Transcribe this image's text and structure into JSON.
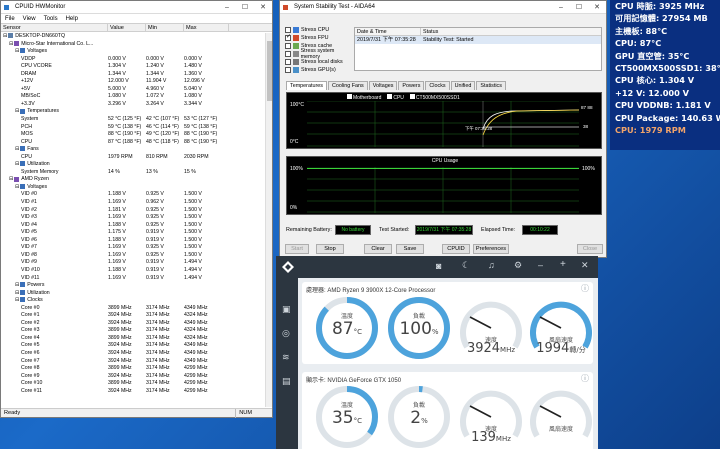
{
  "hwmonitor": {
    "title": "CPUID HWMonitor",
    "menu": [
      "File",
      "View",
      "Tools",
      "Help"
    ],
    "columns": [
      "Sensor",
      "Value",
      "Min",
      "Max"
    ],
    "rows": [
      {
        "i": 0,
        "name": "DESKTOP-DN660TQ",
        "v": "",
        "min": "",
        "max": ""
      },
      {
        "i": 1,
        "name": "Micro-Star International Co. L...",
        "v": "",
        "min": "",
        "max": ""
      },
      {
        "i": 2,
        "name": "Voltages",
        "v": "",
        "min": "",
        "max": ""
      },
      {
        "i": 3,
        "name": "VDDP",
        "v": "0.000 V",
        "min": "0.000 V",
        "max": "0.000 V"
      },
      {
        "i": 3,
        "name": "CPU VCORE",
        "v": "1.304 V",
        "min": "1.240 V",
        "max": "1.480 V"
      },
      {
        "i": 3,
        "name": "DRAM",
        "v": "1.344 V",
        "min": "1.344 V",
        "max": "1.360 V"
      },
      {
        "i": 3,
        "name": "+12V",
        "v": "12.000 V",
        "min": "11.904 V",
        "max": "12.096 V"
      },
      {
        "i": 3,
        "name": "+5V",
        "v": "5.000 V",
        "min": "4.960 V",
        "max": "5.040 V"
      },
      {
        "i": 3,
        "name": "MB/SoC",
        "v": "1.080 V",
        "min": "1.072 V",
        "max": "1.080 V"
      },
      {
        "i": 3,
        "name": "+3.3V",
        "v": "3.296 V",
        "min": "3.264 V",
        "max": "3.344 V"
      },
      {
        "i": 2,
        "name": "Temperatures",
        "v": "",
        "min": "",
        "max": ""
      },
      {
        "i": 3,
        "name": "System",
        "v": "52 °C (125 °F)",
        "min": "42 °C (107 °F)",
        "max": "53 °C (127 °F)"
      },
      {
        "i": 3,
        "name": "PCH",
        "v": "59 °C (138 °F)",
        "min": "46 °C (114 °F)",
        "max": "59 °C (138 °F)"
      },
      {
        "i": 3,
        "name": "MOS",
        "v": "88 °C (190 °F)",
        "min": "49 °C (120 °F)",
        "max": "88 °C (190 °F)"
      },
      {
        "i": 3,
        "name": "CPU",
        "v": "87 °C (188 °F)",
        "min": "48 °C (118 °F)",
        "max": "88 °C (190 °F)"
      },
      {
        "i": 2,
        "name": "Fans",
        "v": "",
        "min": "",
        "max": ""
      },
      {
        "i": 3,
        "name": "CPU",
        "v": "1979 RPM",
        "min": "810 RPM",
        "max": "2030 RPM"
      },
      {
        "i": 2,
        "name": "Utilization",
        "v": "",
        "min": "",
        "max": ""
      },
      {
        "i": 3,
        "name": "System Memory",
        "v": "14 %",
        "min": "13 %",
        "max": "15 %"
      },
      {
        "i": 1,
        "name": "AMD Ryzen",
        "v": "",
        "min": "",
        "max": ""
      },
      {
        "i": 2,
        "name": "Voltages",
        "v": "",
        "min": "",
        "max": ""
      },
      {
        "i": 3,
        "name": "VID #0",
        "v": "1.188 V",
        "min": "0.925 V",
        "max": "1.500 V"
      },
      {
        "i": 3,
        "name": "VID #1",
        "v": "1.169 V",
        "min": "0.962 V",
        "max": "1.500 V"
      },
      {
        "i": 3,
        "name": "VID #2",
        "v": "1.181 V",
        "min": "0.925 V",
        "max": "1.500 V"
      },
      {
        "i": 3,
        "name": "VID #3",
        "v": "1.169 V",
        "min": "0.925 V",
        "max": "1.500 V"
      },
      {
        "i": 3,
        "name": "VID #4",
        "v": "1.188 V",
        "min": "0.925 V",
        "max": "1.500 V"
      },
      {
        "i": 3,
        "name": "VID #5",
        "v": "1.175 V",
        "min": "0.919 V",
        "max": "1.500 V"
      },
      {
        "i": 3,
        "name": "VID #6",
        "v": "1.188 V",
        "min": "0.919 V",
        "max": "1.500 V"
      },
      {
        "i": 3,
        "name": "VID #7",
        "v": "1.169 V",
        "min": "0.925 V",
        "max": "1.500 V"
      },
      {
        "i": 3,
        "name": "VID #8",
        "v": "1.169 V",
        "min": "0.925 V",
        "max": "1.500 V"
      },
      {
        "i": 3,
        "name": "VID #9",
        "v": "1.169 V",
        "min": "0.919 V",
        "max": "1.494 V"
      },
      {
        "i": 3,
        "name": "VID #10",
        "v": "1.188 V",
        "min": "0.919 V",
        "max": "1.494 V"
      },
      {
        "i": 3,
        "name": "VID #11",
        "v": "1.169 V",
        "min": "0.919 V",
        "max": "1.494 V"
      },
      {
        "i": 2,
        "name": "Powers",
        "v": "",
        "min": "",
        "max": ""
      },
      {
        "i": 2,
        "name": "Utilization",
        "v": "",
        "min": "",
        "max": ""
      },
      {
        "i": 2,
        "name": "Clocks",
        "v": "",
        "min": "",
        "max": ""
      },
      {
        "i": 3,
        "name": "Core #0",
        "v": "3899 MHz",
        "min": "3174 MHz",
        "max": "4349 MHz"
      },
      {
        "i": 3,
        "name": "Core #1",
        "v": "3924 MHz",
        "min": "3174 MHz",
        "max": "4324 MHz"
      },
      {
        "i": 3,
        "name": "Core #2",
        "v": "3924 MHz",
        "min": "3174 MHz",
        "max": "4349 MHz"
      },
      {
        "i": 3,
        "name": "Core #3",
        "v": "3899 MHz",
        "min": "3174 MHz",
        "max": "4324 MHz"
      },
      {
        "i": 3,
        "name": "Core #4",
        "v": "3899 MHz",
        "min": "3174 MHz",
        "max": "4324 MHz"
      },
      {
        "i": 3,
        "name": "Core #5",
        "v": "3924 MHz",
        "min": "3174 MHz",
        "max": "4349 MHz"
      },
      {
        "i": 3,
        "name": "Core #6",
        "v": "3924 MHz",
        "min": "3174 MHz",
        "max": "4349 MHz"
      },
      {
        "i": 3,
        "name": "Core #7",
        "v": "3924 MHz",
        "min": "3174 MHz",
        "max": "4349 MHz"
      },
      {
        "i": 3,
        "name": "Core #8",
        "v": "3899 MHz",
        "min": "3174 MHz",
        "max": "4299 MHz"
      },
      {
        "i": 3,
        "name": "Core #9",
        "v": "3924 MHz",
        "min": "3174 MHz",
        "max": "4299 MHz"
      },
      {
        "i": 3,
        "name": "Core #10",
        "v": "3899 MHz",
        "min": "3174 MHz",
        "max": "4299 MHz"
      },
      {
        "i": 3,
        "name": "Core #11",
        "v": "3924 MHz",
        "min": "3174 MHz",
        "max": "4299 MHz"
      }
    ],
    "status_left": "Ready",
    "status_num": "NUM"
  },
  "aida": {
    "title": "System Stability Test - AIDA64",
    "stress": [
      {
        "label": "Stress CPU",
        "checked": false
      },
      {
        "label": "Stress FPU",
        "checked": true
      },
      {
        "label": "Stress cache",
        "checked": false
      },
      {
        "label": "Stress system memory",
        "checked": false
      },
      {
        "label": "Stress local disks",
        "checked": false
      },
      {
        "label": "Stress GPU(s)",
        "checked": false
      }
    ],
    "table_head": [
      "Date & Time",
      "Status"
    ],
    "table_row": [
      "2019/7/31 下午 07:35:28",
      "Stability Test: Started"
    ],
    "tabs": [
      "Temperatures",
      "Cooling Fans",
      "Voltages",
      "Powers",
      "Clocks",
      "Unified",
      "Statistics"
    ],
    "legend": [
      "Motherboard",
      "CPU",
      "CT500MX500SSD1"
    ],
    "temp_top": "100°C",
    "temp_bottom": "0°C",
    "temp_time": "下午 07:35:28",
    "temp_r1": "87 88",
    "temp_r2": "38",
    "usage_title": "CPU Usage",
    "usage_top": "100%",
    "usage_bottom": "0%",
    "usage_right_top": "100%",
    "remaining_label": "Remaining Battery:",
    "remaining_val": "No battery",
    "started_label": "Test Started:",
    "started_val": "2019/7/31 下午 07:35:28",
    "elapsed_label": "Elapsed Time:",
    "elapsed_val": "00:10:22",
    "buttons": {
      "start": "Start",
      "stop": "Stop",
      "clear": "Clear",
      "save": "Save",
      "cpuid": "CPUID",
      "prefs": "Preferences",
      "close": "Close"
    }
  },
  "overlay": {
    "lines": [
      {
        "text": "CPU 時脈: 3925 MHz",
        "color": "#ffffff"
      },
      {
        "text": "可用記憶體: 27954 MB",
        "color": "#ffffff"
      },
      {
        "text": "主機板: 88°C",
        "color": "#ffffff"
      },
      {
        "text": "CPU: 87°C",
        "color": "#ffffff"
      },
      {
        "text": "GPU 直空管: 35°C",
        "color": "#ffffff"
      },
      {
        "text": "CT500MX500SSD1: 38°C",
        "color": "#ffffff"
      },
      {
        "text": "CPU 核心: 1.304 V",
        "color": "#ffffff"
      },
      {
        "text": "+12 V: 12.000 V",
        "color": "#ffffff"
      },
      {
        "text": "CPU VDDNB: 1.181 V",
        "color": "#ffffff"
      },
      {
        "text": "CPU Package: 140.63 W",
        "color": "#ffffff"
      },
      {
        "text": "CPU: 1979 RPM",
        "color": "#f2a46a"
      }
    ]
  },
  "nzxt": {
    "cpu_title": "處理器: AMD Ryzen 9 3900X 12-Core Processor",
    "gpu_title": "顯示卡: NVIDIA GeForce GTX 1050",
    "cpu": {
      "temp_label": "溫度",
      "temp_val": "87",
      "temp_unit": "°C",
      "temp_frac": 0.87,
      "load_label": "負載",
      "load_val": "100",
      "load_unit": "%",
      "load_frac": 1.0,
      "clock_label": "速度",
      "clock_val": "3924",
      "clock_unit": "MHz",
      "fan_label": "風扇速度",
      "fan_val": "1994",
      "fan_unit": "轉/分"
    },
    "gpu": {
      "temp_label": "溫度",
      "temp_val": "35",
      "temp_unit": "°C",
      "temp_frac": 0.35,
      "load_label": "負載",
      "load_val": "2",
      "load_unit": "%",
      "load_frac": 0.02,
      "clock_label": "速度",
      "clock_val": "139",
      "clock_unit": "MHz",
      "fan_label": "風扇速度",
      "fan_val": ""
    },
    "accent": "#4da3dc"
  }
}
